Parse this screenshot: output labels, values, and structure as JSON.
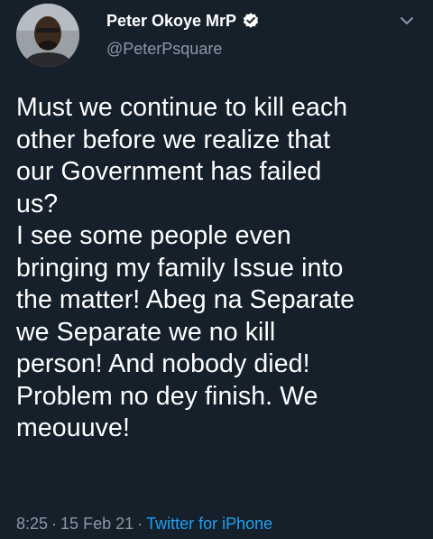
{
  "user": {
    "display_name": "Peter Okoye MrP",
    "handle": "@PeterPsquare",
    "verified": true,
    "avatar_icon": "profile-photo"
  },
  "tweet": {
    "lines": [
      "Must we continue to kill each",
      "other before we realize that",
      "our Government has failed",
      "us?",
      "I see some people even",
      "bringing my family Issue into",
      "the matter! Abeg na Separate",
      "we Separate we no kill",
      "person! And nobody died!",
      "Problem no dey finish. We",
      "meouuve!"
    ]
  },
  "meta": {
    "time": "8:25",
    "separator": "·",
    "date": "15 Feb 21",
    "source": "Twitter for iPhone"
  },
  "colors": {
    "background": "#15202b",
    "text": "#ffffff",
    "secondary": "#8899a6",
    "accent": "#1da1f2"
  }
}
